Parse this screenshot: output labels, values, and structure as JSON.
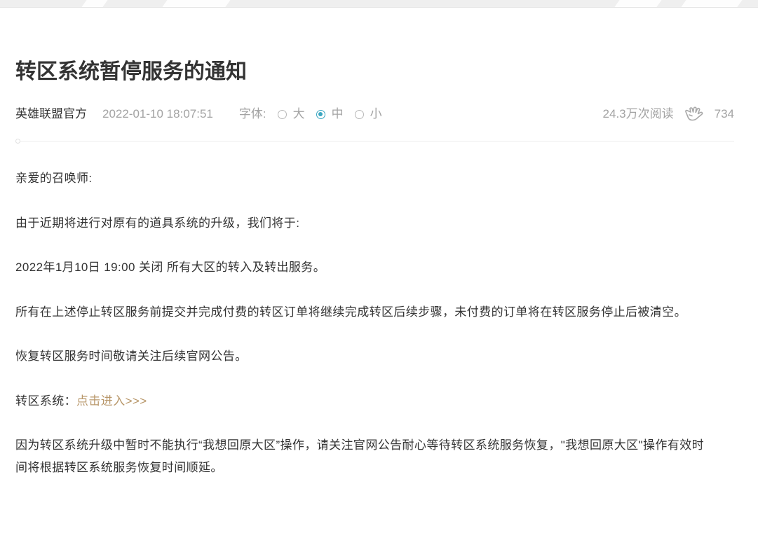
{
  "article": {
    "title": "转区系统暂停服务的通知",
    "meta": {
      "author": "英雄联盟官方",
      "datetime": "2022-01-10 18:07:51",
      "font_size_label": "字体:",
      "font_size_options": [
        {
          "label": "大",
          "selected": false
        },
        {
          "label": "中",
          "selected": true
        },
        {
          "label": "小",
          "selected": false
        }
      ],
      "views": "24.3万次阅读",
      "likes": "734"
    },
    "body": {
      "paragraphs": [
        "亲爱的召唤师:",
        "由于近期将进行对原有的道具系统的升级，我们将于:",
        "2022年1月10日 19:00 关闭 所有大区的转入及转出服务。",
        "所有在上述停止转区服务前提交并完成付费的转区订单将继续完成转区后续步骤，未付费的订单将在转区服务停止后被清空。",
        "恢复转区服务时间敬请关注后续官网公告。"
      ],
      "link_line": {
        "prefix": "转区系统：",
        "link_text": "点击进入>>>"
      },
      "closing_paragraph": "因为转区系统升级中暂时不能执行“我想回原大区”操作，请关注官网公告耐心等待转区系统服务恢复，\"我想回原大区\"操作有效时间将根据转区系统服务恢复时间顺延。"
    }
  },
  "icons": {
    "like": "hand-icon",
    "radio": "radio-icon"
  },
  "colors": {
    "accent": "#3aa6c1",
    "link": "#b8976a",
    "text": "#333333",
    "meta": "#a3a3a3"
  }
}
